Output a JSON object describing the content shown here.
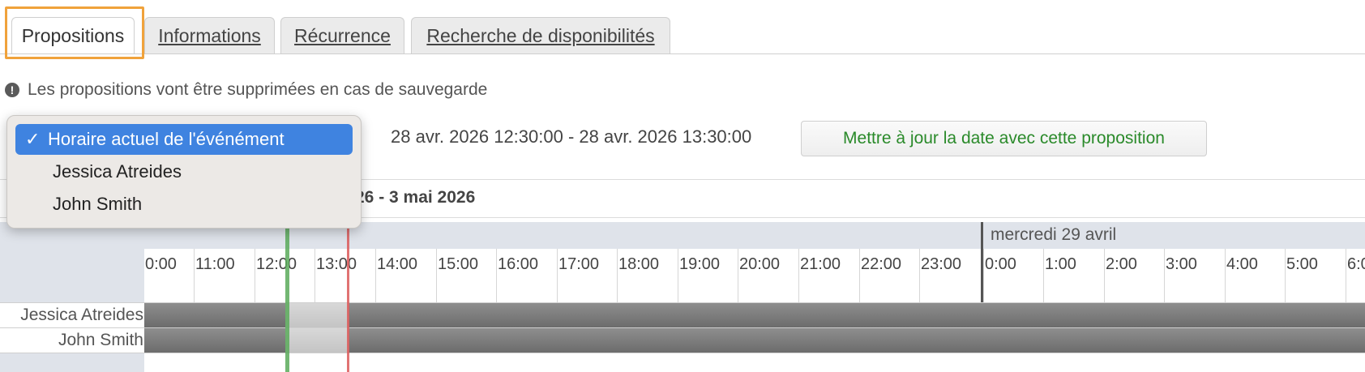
{
  "tabs": [
    {
      "label": "Propositions",
      "active": true
    },
    {
      "label": "Informations",
      "active": false
    },
    {
      "label": "Récurrence",
      "active": false
    },
    {
      "label": "Recherche de disponibilités",
      "active": false
    }
  ],
  "notice": {
    "icon": "exclamation-circle-icon",
    "text": "Les propositions vont être supprimées en cas de sauvegarde"
  },
  "proposition": {
    "range": "28 avr. 2026 12:30:00 - 28 avr. 2026 13:30:00",
    "update_button": "Mettre à jour la date avec cette proposition"
  },
  "dropdown": {
    "check_glyph": "✓",
    "options": [
      {
        "label": "Horaire actuel de l'événément",
        "selected": true
      },
      {
        "label": "Jessica Atreides",
        "selected": false
      },
      {
        "label": "John Smith",
        "selected": false
      }
    ]
  },
  "week": {
    "range_fragment": "26 - 3 mai 2026"
  },
  "timeline": {
    "day_label": "mercredi 29 avril",
    "hours": [
      "0:00",
      "11:00",
      "12:00",
      "13:00",
      "14:00",
      "15:00",
      "16:00",
      "17:00",
      "18:00",
      "19:00",
      "20:00",
      "21:00",
      "22:00",
      "23:00",
      "0:00",
      "1:00",
      "2:00",
      "3:00",
      "4:00",
      "5:00",
      "6:0"
    ],
    "attendees": [
      "Jessica Atreides",
      "John Smith"
    ]
  },
  "colors": {
    "focus_outline": "#f0a23b",
    "update_button_text": "#2a8a2a",
    "selected_option": "#3f83e0",
    "busy": "#7a7a7a",
    "start_marker": "#5aaa5a",
    "end_marker": "#dc5a5a"
  }
}
